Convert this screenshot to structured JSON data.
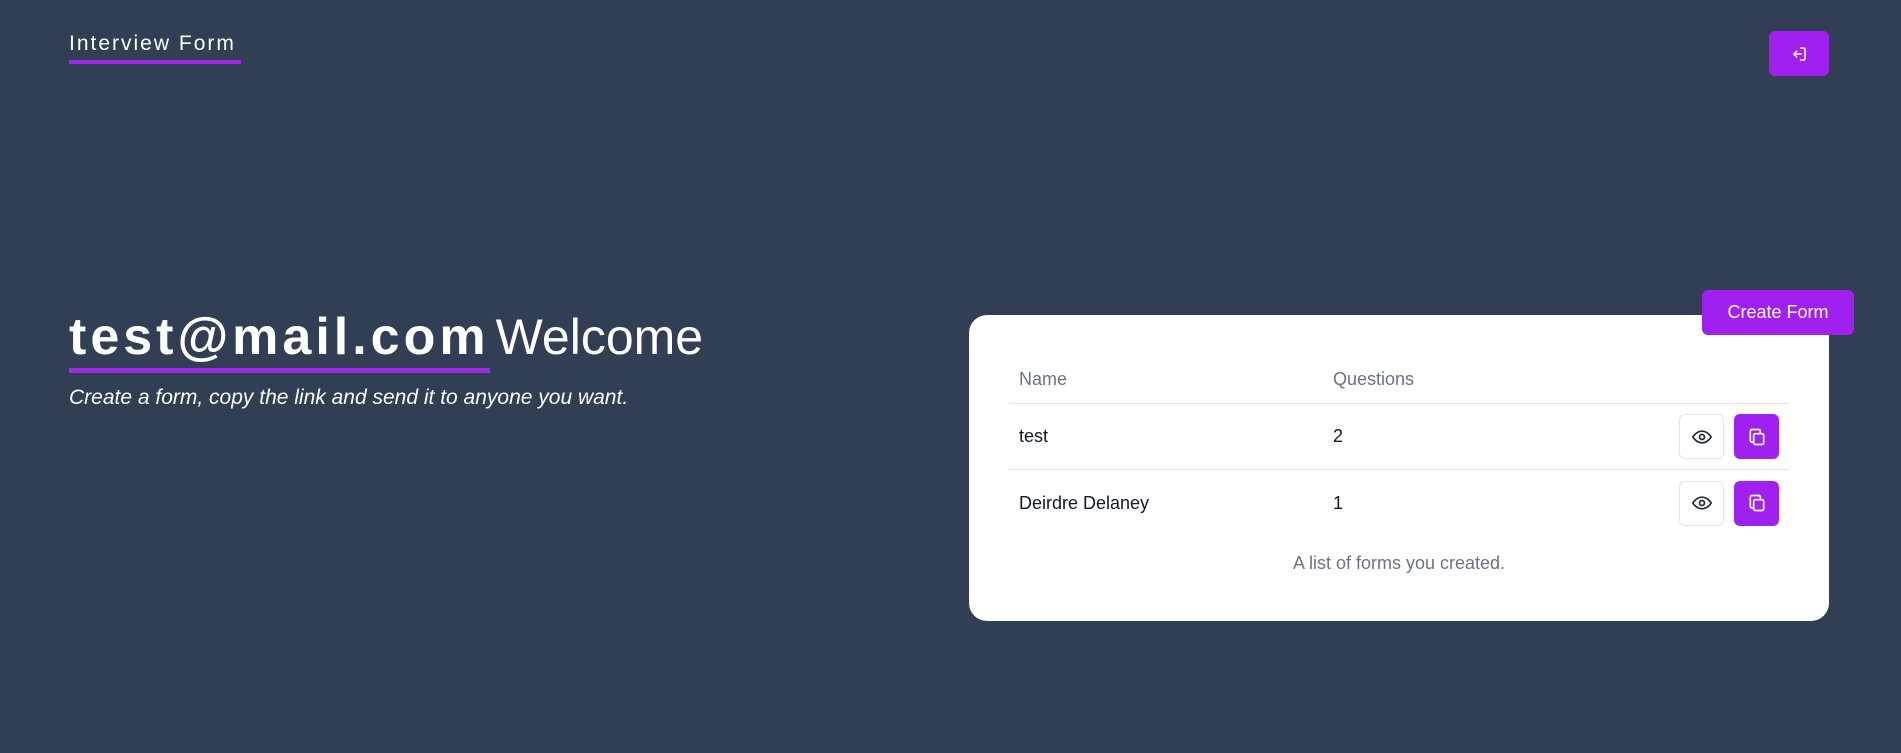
{
  "header": {
    "brand": "Interview Form",
    "logout_icon": "logout-icon"
  },
  "hero": {
    "email": "test@mail.com",
    "welcome": "Welcome",
    "subtitle": "Create a form, copy the link and send it to anyone you want."
  },
  "forms": {
    "create_label": "Create Form",
    "columns": [
      "Name",
      "Questions"
    ],
    "rows": [
      {
        "name": "test",
        "questions": "2"
      },
      {
        "name": "Deirdre Delaney",
        "questions": "1"
      }
    ],
    "caption": "A list of forms you created."
  },
  "colors": {
    "background": "#323e53",
    "accent": "#a020f0"
  }
}
